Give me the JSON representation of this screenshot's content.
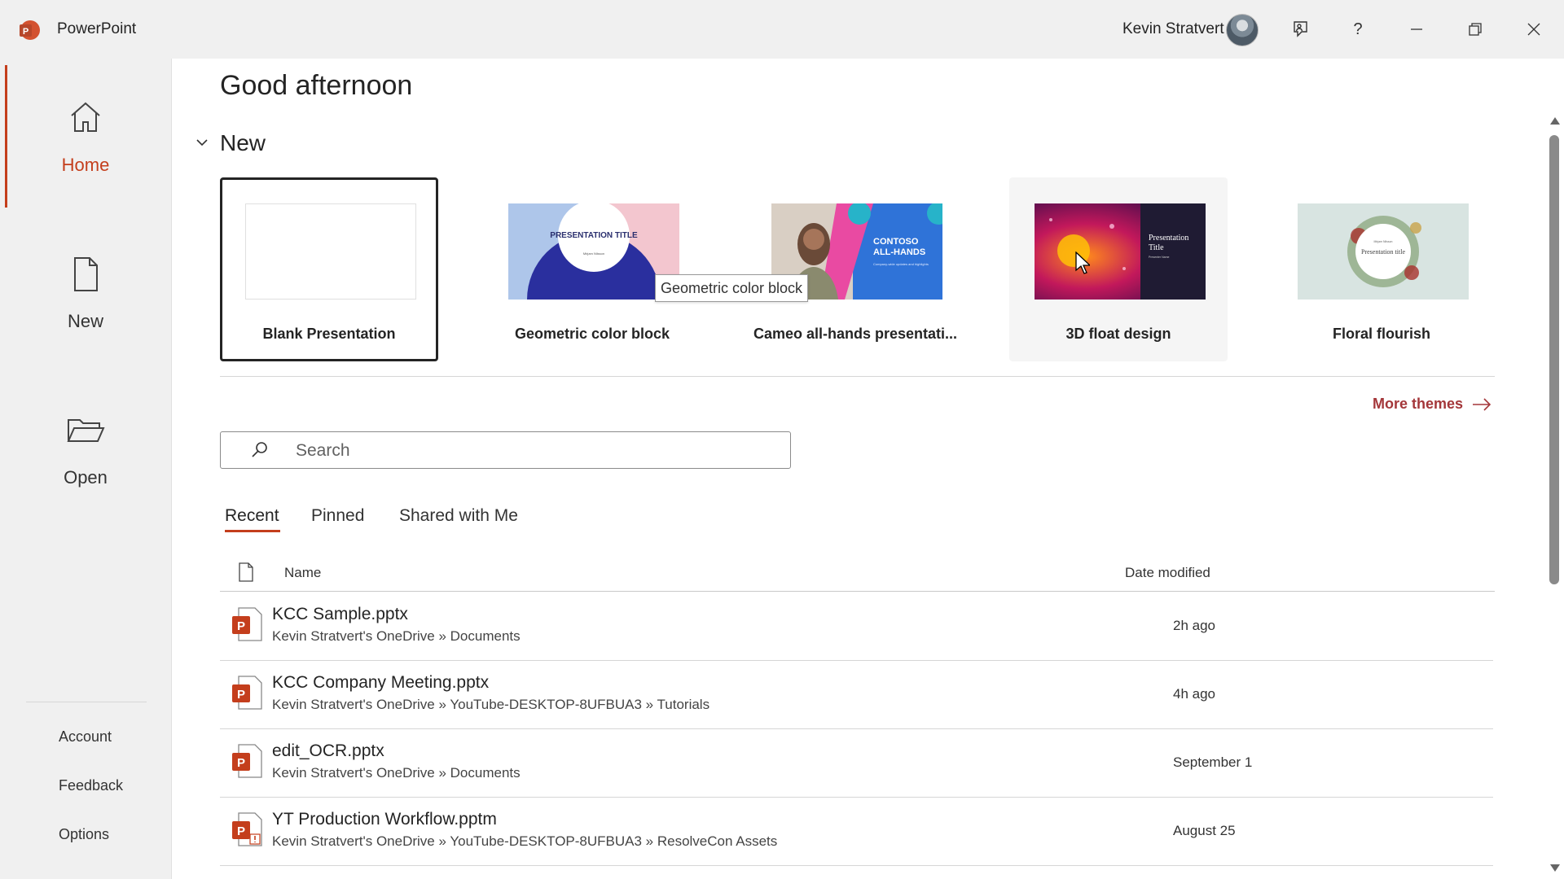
{
  "app": {
    "name": "PowerPoint",
    "accent": "#c43e1c",
    "logo_letter": "P"
  },
  "titlebar": {
    "user": "Kevin Stratvert",
    "icons": [
      "feedback-icon",
      "help-icon",
      "minimize-icon",
      "restore-icon",
      "close-icon"
    ],
    "help_glyph": "?"
  },
  "nav": {
    "items": [
      {
        "label": "Home",
        "icon": "home-icon"
      },
      {
        "label": "New",
        "icon": "new-file-icon"
      },
      {
        "label": "Open",
        "icon": "folder-icon"
      }
    ],
    "bottom": [
      "Account",
      "Feedback",
      "Options"
    ]
  },
  "main": {
    "greeting": "Good afternoon",
    "new_heading": "New",
    "templates": [
      {
        "label": "Blank Presentation"
      },
      {
        "label": "Geometric color block",
        "thumb_title": "PRESENTATION TITLE",
        "thumb_sub": "Mirjam Nilsson"
      },
      {
        "label": "Cameo all-hands presentati...",
        "thumb_title_1": "CONTOSO",
        "thumb_title_2": "ALL-HANDS",
        "thumb_sub": "Company-wide updates and highlights"
      },
      {
        "label": "3D float design",
        "thumb_title_1": "Presentation",
        "thumb_title_2": "Title",
        "thumb_sub": "Presenter Name"
      },
      {
        "label": "Floral flourish",
        "thumb_sub_top": "Mirjam Nilsson",
        "thumb_title": "Presentation title"
      }
    ],
    "tooltip": "Geometric color block",
    "more_themes": "More themes",
    "search_placeholder": "Search",
    "tabs": [
      "Recent",
      "Pinned",
      "Shared with Me"
    ],
    "columns": {
      "name": "Name",
      "date": "Date modified"
    },
    "files": [
      {
        "name": "KCC Sample.pptx",
        "path": "Kevin Stratvert's OneDrive » Documents",
        "date": "2h ago",
        "type": "pptx"
      },
      {
        "name": "KCC Company Meeting.pptx",
        "path": "Kevin Stratvert's OneDrive » YouTube-DESKTOP-8UFBUA3 » Tutorials",
        "date": "4h ago",
        "type": "pptx"
      },
      {
        "name": "edit_OCR.pptx",
        "path": "Kevin Stratvert's OneDrive » Documents",
        "date": "September 1",
        "type": "pptx"
      },
      {
        "name": "YT Production Workflow.pptm",
        "path": "Kevin Stratvert's OneDrive » YouTube-DESKTOP-8UFBUA3 » ResolveCon Assets",
        "date": "August 25",
        "type": "pptm"
      }
    ]
  }
}
